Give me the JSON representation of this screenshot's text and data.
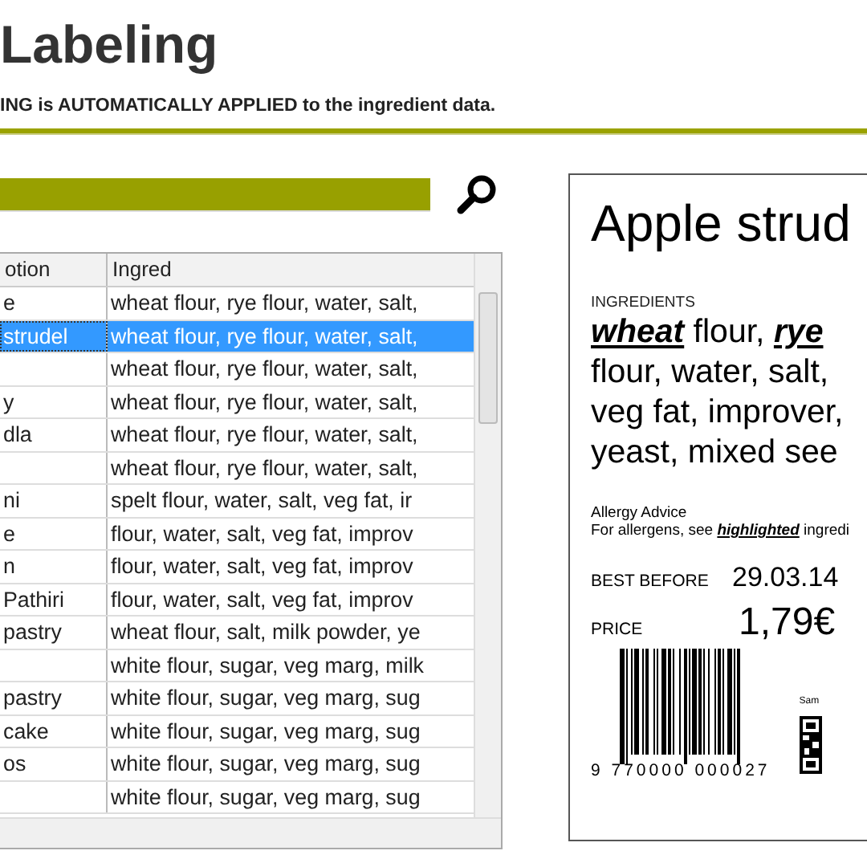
{
  "header": {
    "title": "Labeling",
    "subtitle": "ING is AUTOMATICALLY APPLIED to the ingredient data."
  },
  "table": {
    "columns": [
      "otion",
      "Ingred"
    ],
    "rows": [
      {
        "description": "e",
        "ingredients": "wheat flour, rye flour, water, salt,",
        "selected": false
      },
      {
        "description": "strudel",
        "ingredients": "wheat flour, rye flour, water, salt,",
        "selected": true
      },
      {
        "ingredients": "wheat flour, rye flour, water, salt,",
        "selected": false
      },
      {
        "description": "y",
        "ingredients": "wheat flour, rye flour, water, salt,",
        "selected": false
      },
      {
        "description": "dla",
        "ingredients": "wheat flour, rye flour, water, salt,",
        "selected": false
      },
      {
        "ingredients": "wheat flour, rye flour, water, salt,",
        "selected": false
      },
      {
        "description": "ni",
        "ingredients": "spelt flour, water, salt, veg fat, ir",
        "selected": false
      },
      {
        "description": "e",
        "ingredients": "flour, water, salt, veg fat, improv",
        "selected": false
      },
      {
        "description": "n",
        "ingredients": "flour, water, salt, veg fat, improv",
        "selected": false
      },
      {
        "description": "Pathiri",
        "ingredients": "flour, water, salt, veg fat, improv",
        "selected": false
      },
      {
        "description": "pastry",
        "ingredients": "wheat flour, salt, milk powder, ye",
        "selected": false
      },
      {
        "ingredients": "white flour, sugar, veg marg, milk",
        "selected": false
      },
      {
        "description": "pastry",
        "ingredients": "white flour, sugar, veg marg, sug",
        "selected": false
      },
      {
        "description": "cake",
        "ingredients": "white flour, sugar, veg marg, sug",
        "selected": false
      },
      {
        "description": "os",
        "ingredients": "white flour, sugar, veg marg, sug",
        "selected": false
      },
      {
        "ingredients": "white flour, sugar, veg marg, sug",
        "selected": false
      }
    ]
  },
  "label": {
    "product": "Apple strud",
    "ingredients_heading": "INGREDIENTS",
    "ingredient_lines": [
      "**wheat** flour, **rye**",
      "flour, water, salt,",
      "veg fat, improver,",
      "yeast, mixed see"
    ],
    "allergy_heading": "Allergy Advice",
    "allergy_text": "For allergens, see **highlighted** ingredi",
    "best_before_label": "BEST BEFORE",
    "best_before": "29.03.14",
    "price_label": "PRICE",
    "price": "1,79€",
    "barcode_number": "9 770000 000027",
    "sample_text": "Sam"
  }
}
